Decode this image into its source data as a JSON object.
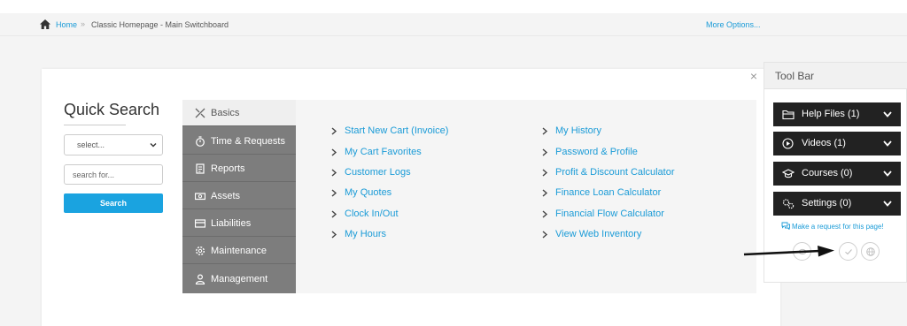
{
  "breadcrumb": {
    "home": "Home",
    "separator": "»",
    "current": "Classic Homepage - Main Switchboard",
    "more_options": "More Options..."
  },
  "quick_search": {
    "title": "Quick Search",
    "select_value": "select...",
    "search_placeholder": "search for...",
    "search_button": "Search"
  },
  "side_menu": {
    "items": [
      {
        "label": "Basics",
        "icon": "tools-icon",
        "active": true
      },
      {
        "label": "Time & Requests",
        "icon": "stopwatch-icon"
      },
      {
        "label": "Reports",
        "icon": "report-icon"
      },
      {
        "label": "Assets",
        "icon": "money-icon"
      },
      {
        "label": "Liabilities",
        "icon": "card-icon"
      },
      {
        "label": "Maintenance",
        "icon": "gear-icon"
      },
      {
        "label": "Management",
        "icon": "person-icon"
      }
    ]
  },
  "links": {
    "col1": [
      "Start New Cart (Invoice)",
      "My Cart Favorites",
      "Customer Logs",
      "My Quotes",
      "Clock In/Out",
      "My Hours"
    ],
    "col2": [
      "My History",
      "Password & Profile",
      "Profit & Discount Calculator",
      "Finance Loan Calculator",
      "Financial Flow Calculator",
      "View Web Inventory"
    ]
  },
  "toolbar": {
    "title": "Tool Bar",
    "close": "×",
    "items": [
      {
        "label": "Help Files (1)",
        "icon": "folder-icon"
      },
      {
        "label": "Videos (1)",
        "icon": "play-circle-icon"
      },
      {
        "label": "Courses (0)",
        "icon": "graduation-cap-icon"
      },
      {
        "label": "Settings (0)",
        "icon": "gears-icon"
      }
    ],
    "request_link": "Make a request for this page!"
  },
  "colors": {
    "accent": "#1a9bd7",
    "button": "#1aa3e0",
    "menu_bg": "#7d7d7d",
    "toolbar_item": "#222222"
  }
}
